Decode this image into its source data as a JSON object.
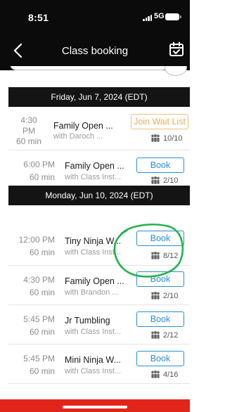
{
  "status": {
    "time": "8:51",
    "network": "5G"
  },
  "header": {
    "title": "Class booking"
  },
  "days": [
    {
      "label": "Friday, Jun 7, 2024 (EDT)",
      "classes": [
        {
          "time": "4:30 PM",
          "duration": "60 min",
          "name": "Family Open ...",
          "instructor": "with Daroch ...",
          "action": "Join Wait List",
          "capacity": "10/10"
        },
        {
          "time": "6:00 PM",
          "duration": "60 min",
          "name": "Family Open ...",
          "instructor": "with Class Inst...",
          "action": "Book",
          "capacity": "2/10"
        }
      ]
    },
    {
      "label": "Monday, Jun 10, 2024 (EDT)",
      "classes": [
        {
          "time": "12:00 PM",
          "duration": "60 min",
          "name": "Tiny Ninja W...",
          "instructor": "with Class Inst...",
          "action": "Book",
          "capacity": "8/12"
        },
        {
          "time": "4:30 PM",
          "duration": "60 min",
          "name": "Family Open ...",
          "instructor": "with Brandon ...",
          "action": "Book",
          "capacity": "2/10"
        },
        {
          "time": "5:45 PM",
          "duration": "60 min",
          "name": "Jr Tumbling",
          "instructor": "with Class Inst...",
          "action": "Book",
          "capacity": "2/12"
        },
        {
          "time": "5:45 PM",
          "duration": "60 min",
          "name": "Mini Ninja W...",
          "instructor": "with Class Inst...",
          "action": "Book",
          "capacity": "4/16"
        }
      ]
    }
  ],
  "colors": {
    "accent": "#2a8fd0",
    "waitlist": "#e5b15b",
    "header_bg": "#0b0b0b",
    "annotation": "#22b24c",
    "bottom_bar": "#e1251b"
  }
}
